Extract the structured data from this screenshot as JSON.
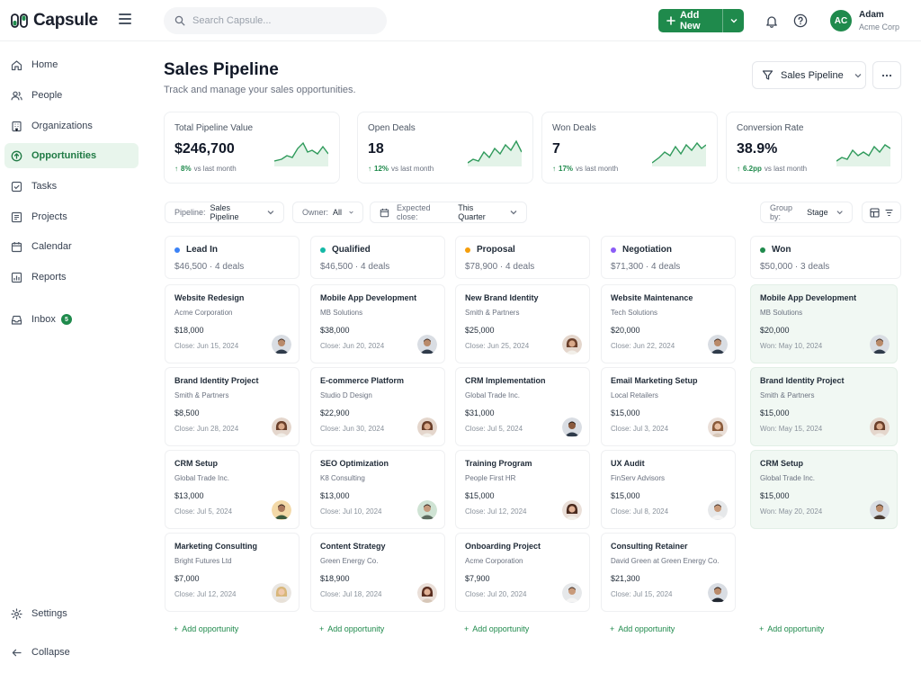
{
  "app": {
    "logo_text": "Capsule"
  },
  "search": {
    "placeholder": "Search Capsule..."
  },
  "topbar": {
    "add_new_label": "Add New",
    "avatar_initials": "AC",
    "user_name": "Adam",
    "user_org": "Acme Corp"
  },
  "sidebar": {
    "items": [
      {
        "label": "Home",
        "icon": "home-icon"
      },
      {
        "label": "People",
        "icon": "people-icon"
      },
      {
        "label": "Organizations",
        "icon": "building-icon"
      },
      {
        "label": "Opportunities",
        "icon": "target-icon",
        "active": true
      },
      {
        "label": "Tasks",
        "icon": "checkbox-icon"
      },
      {
        "label": "Projects",
        "icon": "projects-icon"
      },
      {
        "label": "Calendar",
        "icon": "calendar-icon"
      },
      {
        "label": "Reports",
        "icon": "reports-icon"
      },
      {
        "label": "Inbox",
        "icon": "inbox-icon",
        "badge": "5"
      }
    ],
    "settings_label": "Settings",
    "collapse_label": "Collapse"
  },
  "header": {
    "title": "Sales Pipeline",
    "subtitle": "Track and manage your sales opportunities.",
    "view_select": "Sales Pipeline"
  },
  "stats": [
    {
      "label": "Total Pipeline Value",
      "value": "$246,700",
      "change": "8%",
      "suffix": "vs last month"
    },
    {
      "label": "Open Deals",
      "value": "18",
      "change": "12%",
      "suffix": "vs last month"
    },
    {
      "label": "Won Deals",
      "value": "7",
      "change": "17%",
      "suffix": "vs last month"
    },
    {
      "label": "Conversion Rate",
      "value": "38.9%",
      "change": "6.2pp",
      "suffix": "vs last month"
    }
  ],
  "filters": {
    "pipeline_prefix": "Pipeline:",
    "pipeline_value": "Sales Pipeline",
    "owner_prefix": "Owner:",
    "owner_value": "All",
    "close_prefix": "Expected close:",
    "close_value": "This Quarter",
    "group_prefix": "Group by:",
    "group_value": "Stage"
  },
  "colors": {
    "accent": "#1f8a4c",
    "lead_in": "#3b82f6",
    "qualified": "#14b8a6",
    "proposal": "#f59e0b",
    "negotiation": "#8b5cf6",
    "won": "#1f8a4c"
  },
  "board": {
    "add_label": "Add opportunity",
    "columns": [
      {
        "name": "Lead In",
        "total": "$46,500",
        "count": "4 deals",
        "cards": [
          {
            "title": "Website Redesign",
            "company": "Acme Corporation",
            "value": "$18,000",
            "close": "Close: Jun 15, 2024"
          },
          {
            "title": "Brand Identity Project",
            "company": "Smith & Partners",
            "value": "$8,500",
            "close": "Close: Jun 28, 2024"
          },
          {
            "title": "CRM Setup",
            "company": "Global Trade Inc.",
            "value": "$13,000",
            "close": "Close: Jul 5, 2024"
          },
          {
            "title": "Marketing Consulting",
            "company": "Bright Futures Ltd",
            "value": "$7,000",
            "close": "Close: Jul 12, 2024"
          }
        ]
      },
      {
        "name": "Qualified",
        "total": "$46,500",
        "count": "4 deals",
        "cards": [
          {
            "title": "Mobile App Development",
            "company": "MB Solutions",
            "value": "$38,000",
            "close": "Close: Jun 20, 2024"
          },
          {
            "title": "E-commerce Platform",
            "company": "Studio D Design",
            "value": "$22,900",
            "close": "Close: Jun 30, 2024"
          },
          {
            "title": "SEO Optimization",
            "company": "K8 Consulting",
            "value": "$13,000",
            "close": "Close: Jul 10, 2024"
          },
          {
            "title": "Content Strategy",
            "company": "Green Energy Co.",
            "value": "$18,900",
            "close": "Close: Jul 18, 2024"
          }
        ]
      },
      {
        "name": "Proposal",
        "total": "$78,900",
        "count": "4 deals",
        "cards": [
          {
            "title": "New Brand Identity",
            "company": "Smith & Partners",
            "value": "$25,000",
            "close": "Close: Jun 25, 2024"
          },
          {
            "title": "CRM Implementation",
            "company": "Global Trade Inc.",
            "value": "$31,000",
            "close": "Close: Jul 5, 2024"
          },
          {
            "title": "Training Program",
            "company": "People First HR",
            "value": "$15,000",
            "close": "Close: Jul 12, 2024"
          },
          {
            "title": "Onboarding Project",
            "company": "Acme Corporation",
            "value": "$7,900",
            "close": "Close: Jul 20, 2024"
          }
        ]
      },
      {
        "name": "Negotiation",
        "total": "$71,300",
        "count": "4 deals",
        "cards": [
          {
            "title": "Website Maintenance",
            "company": "Tech Solutions",
            "value": "$20,000",
            "close": "Close: Jun 22, 2024"
          },
          {
            "title": "Email Marketing Setup",
            "company": "Local Retailers",
            "value": "$15,000",
            "close": "Close: Jul 3, 2024"
          },
          {
            "title": "UX Audit",
            "company": "FinServ Advisors",
            "value": "$15,000",
            "close": "Close: Jul 8, 2024"
          },
          {
            "title": "Consulting Retainer",
            "company": "David Green at Green Energy Co.",
            "value": "$21,300",
            "close": "Close: Jul 15, 2024"
          }
        ]
      },
      {
        "name": "Won",
        "total": "$50,000",
        "count": "3 deals",
        "cards": [
          {
            "title": "Mobile App Development",
            "company": "MB Solutions",
            "value": "$20,000",
            "close": "Won: May 10, 2024"
          },
          {
            "title": "Brand Identity Project",
            "company": "Smith & Partners",
            "value": "$15,000",
            "close": "Won: May 15, 2024"
          },
          {
            "title": "CRM Setup",
            "company": "Global Trade Inc.",
            "value": "$15,000",
            "close": "Won: May 20, 2024"
          }
        ]
      }
    ]
  }
}
